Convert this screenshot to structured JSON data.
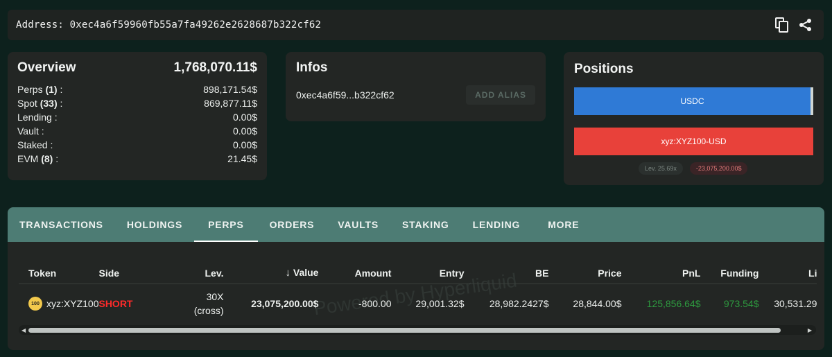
{
  "address_bar": {
    "label": "Address:",
    "value": "0xec4a6f59960fb55a7fa49262e2628687b322cf62",
    "copy_icon": "copy-icon",
    "share_icon": "share-icon"
  },
  "overview": {
    "title": "Overview",
    "total": "1,768,070.11$",
    "rows": [
      {
        "label": "Perps",
        "count": "(1)",
        "suffix": " :",
        "value": "898,171.54$"
      },
      {
        "label": "Spot",
        "count": "(33)",
        "suffix": " :",
        "value": "869,877.11$"
      },
      {
        "label": "Lending :",
        "count": "",
        "suffix": "",
        "value": "0.00$"
      },
      {
        "label": "Vault :",
        "count": "",
        "suffix": "",
        "value": "0.00$"
      },
      {
        "label": "Staked :",
        "count": "",
        "suffix": "",
        "value": "0.00$"
      },
      {
        "label": "EVM",
        "count": "(8)",
        "suffix": " :",
        "value": "21.45$"
      }
    ]
  },
  "infos": {
    "title": "Infos",
    "short_address": "0xec4a6f59...b322cf62",
    "alias_button": "ADD ALIAS"
  },
  "positions": {
    "title": "Positions",
    "bars": [
      {
        "label": "USDC",
        "color": "#2f7ad6"
      },
      {
        "label": "xyz:XYZ100-USD",
        "color": "#e8413a"
      }
    ],
    "leverage_label": "Lev.",
    "leverage_value": "25.69x",
    "pnl": "-23,075,200.00$"
  },
  "tabs": [
    "TRANSACTIONS",
    "HOLDINGS",
    "PERPS",
    "ORDERS",
    "VAULTS",
    "STAKING",
    "LENDING",
    "MORE"
  ],
  "active_tab": "PERPS",
  "perps_table": {
    "headers": [
      "Token",
      "Side",
      "Lev.",
      "Value",
      "Amount",
      "Entry",
      "BE",
      "Price",
      "PnL",
      "Funding",
      "Li"
    ],
    "sort_icon": "arrow-down-icon",
    "row": {
      "token_logo": "100",
      "token": "xyz:XYZ100",
      "side": "SHORT",
      "lev_line1": "30X",
      "lev_line2": "(cross)",
      "value": "23,075,200.00$",
      "amount": "-800.00",
      "entry": "29,001.32$",
      "be": "28,982.2427$",
      "price": "28,844.00$",
      "pnl": "125,856.64$",
      "funding": "973.54$",
      "liq": "30,531.29"
    },
    "watermark": "Powered by Hyperliquid"
  }
}
